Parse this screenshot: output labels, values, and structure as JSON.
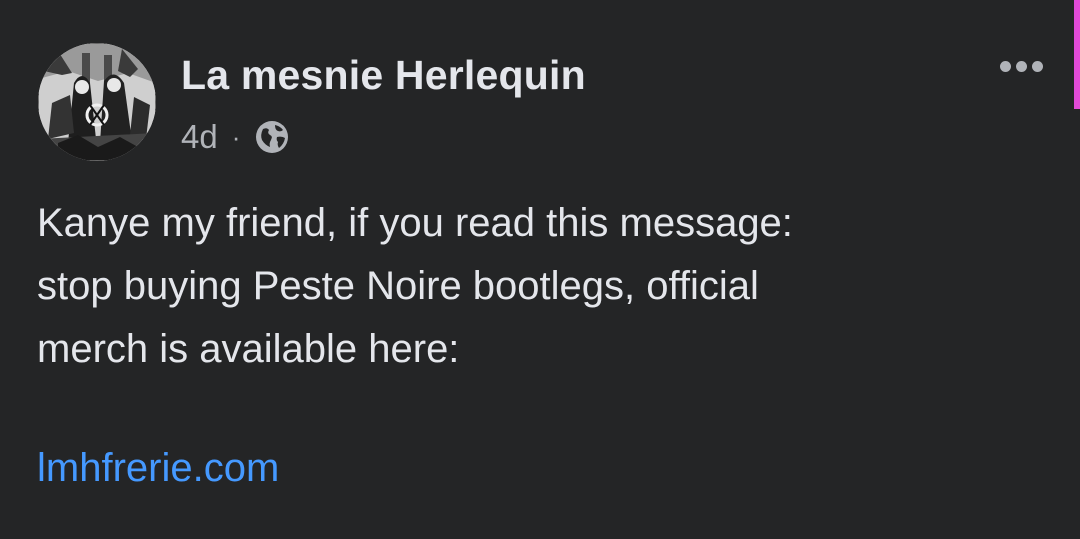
{
  "post": {
    "author": "La mesnie Herlequin",
    "timestamp": "4d",
    "separator": "·",
    "audience_icon": "globe-icon",
    "more_icon": "more-options-icon",
    "body_lines": [
      "Kanye my friend, if you read this message:",
      "stop buying Peste Noire bootlegs, official",
      "merch is available here:"
    ],
    "link": "lmhfrerie.com"
  },
  "colors": {
    "background": "#242526",
    "primary_text": "#e4e6eb",
    "secondary_text": "#b0b3b8",
    "link": "#4599ff",
    "accent_bar": "#e24bd7"
  }
}
